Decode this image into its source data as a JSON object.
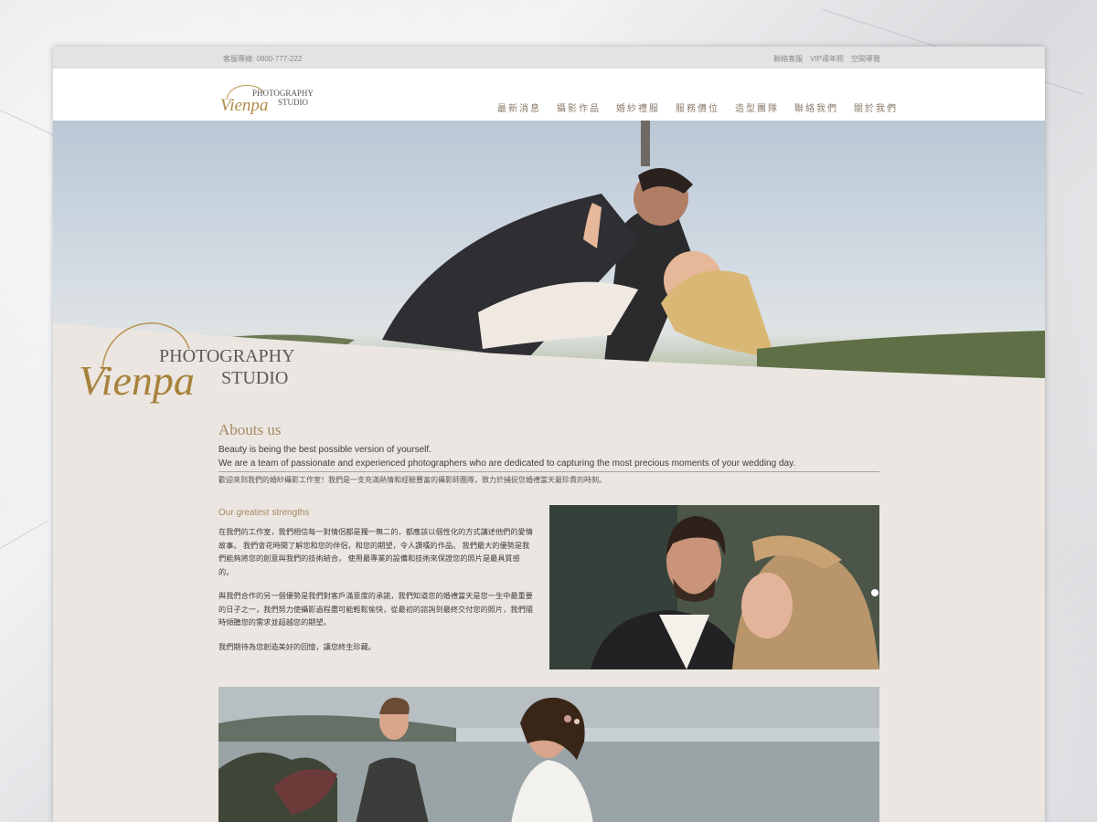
{
  "topbar": {
    "hotline": "客服專線: 0800-777-222",
    "links": [
      "聯絡客服",
      "VIP週年照",
      "空間導覽"
    ]
  },
  "brand": {
    "script": "Vienpa",
    "line1": "PHOTOGRAPHY",
    "line2": "STUDIO"
  },
  "nav": {
    "items": [
      "最新消息",
      "攝影作品",
      "婚紗禮服",
      "服務價位",
      "造型團隊",
      "聯絡我們",
      "關於我們"
    ]
  },
  "about": {
    "title": "Abouts us",
    "line1": "Beauty is being the best possible version of yourself.",
    "line2": "We are a team of passionate and experienced photographers who are dedicated to capturing the most precious moments of your wedding day.",
    "zh": "歡迎來到我們的婚紗攝影工作室！我們是一支充滿熱情和經驗豐富的攝影師團隊，致力於捕捉您婚禮當天最珍貴的時刻。"
  },
  "strengths": {
    "title": "Our greatest strengths",
    "p1": "在我們的工作室，我們相信每一對情侶都是獨一無二的，都應該以個性化的方式講述他們的愛情故事。 我們會花時間了解您和您的伴侶，和您的期望，令人讚嘆的作品。 我們最大的優勢是我們能夠將您的創意與我們的技術結合， 使用最專業的設備和技術來保證您的照片是最具質感的。",
    "p2": "與我們合作的另一個優勢是我們對客戶滿意度的承諾，我們知道您的婚禮當天是您一生中最重要的日子之一，我們努力使攝影過程盡可能輕鬆愉快，從最初的諮詢到最終交付您的照片，我們隨時傾聽您的需求並超越您的期望。",
    "p3": "我們期待為您創造美好的回憶，讓您終生珍藏。"
  },
  "colors": {
    "gold": "#a58c63",
    "page_bg": "#ebe6e1",
    "nav_text": "#8a7a6a"
  }
}
